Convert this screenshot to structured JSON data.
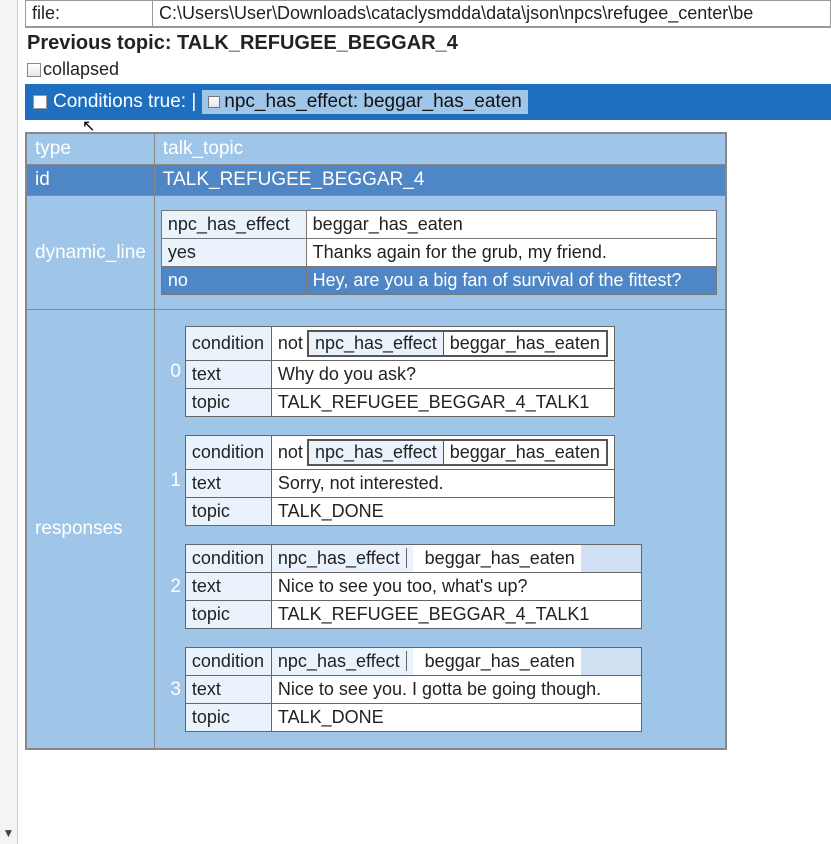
{
  "file": {
    "label": "file:",
    "path": "C:\\Users\\User\\Downloads\\cataclysmdda\\data\\json\\npcs\\refugee_center\\be"
  },
  "previous_topic_label": "Previous topic: TALK_REFUGEE_BEGGAR_4",
  "collapsed_label": "collapsed",
  "conditions_bar": {
    "label": "Conditions true: |",
    "pill": "npc_has_effect: beggar_has_eaten"
  },
  "fields": {
    "type": {
      "label": "type",
      "value": "talk_topic"
    },
    "id": {
      "label": "id",
      "value": "TALK_REFUGEE_BEGGAR_4"
    }
  },
  "dynamic_line": {
    "label": "dynamic_line",
    "effect_key": "npc_has_effect",
    "effect_val": "beggar_has_eaten",
    "yes_key": "yes",
    "yes_val": "Thanks again for the grub, my friend.",
    "no_key": "no",
    "no_val": "Hey, are you a big fan of survival of the fittest?"
  },
  "responses_label": "responses",
  "cond_labels": {
    "condition": "condition",
    "not": "not",
    "effect": "npc_has_effect",
    "val": "beggar_has_eaten",
    "text": "text",
    "topic": "topic"
  },
  "responses": [
    {
      "idx": "0",
      "has_not": true,
      "text": "Why do you ask?",
      "topic": "TALK_REFUGEE_BEGGAR_4_TALK1"
    },
    {
      "idx": "1",
      "has_not": true,
      "text": "Sorry, not interested.",
      "topic": "TALK_DONE"
    },
    {
      "idx": "2",
      "has_not": false,
      "text": "Nice to see you too, what's up?",
      "topic": "TALK_REFUGEE_BEGGAR_4_TALK1"
    },
    {
      "idx": "3",
      "has_not": false,
      "text": "Nice to see you. I gotta be going though.",
      "topic": "TALK_DONE"
    }
  ]
}
